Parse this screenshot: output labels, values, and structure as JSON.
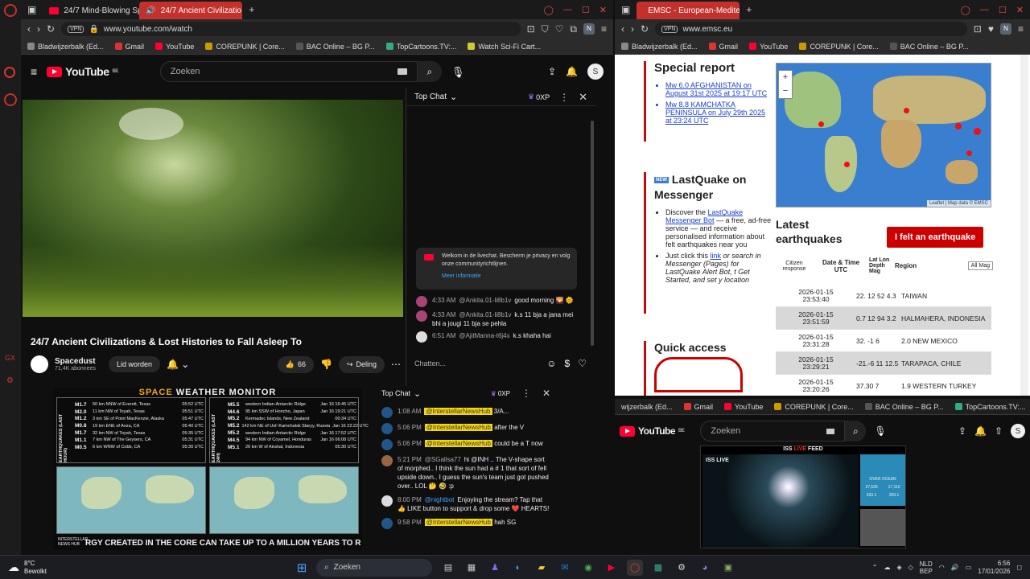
{
  "left_browser": {
    "tabs": [
      {
        "label": "24/7 Mind-Blowing Space",
        "active": false
      },
      {
        "label": "24/7 Ancient Civilizatio",
        "active": true
      }
    ],
    "url": "www.youtube.com/watch",
    "vpn": "VPN",
    "bookmarks": [
      "Bladwijzerbalk (Ed...",
      "Gmail",
      "YouTube",
      "COREPUNK | Core...",
      "BAC Online – BG P...",
      "TopCartoons.TV:...",
      "Watch Sci-Fi Cart..."
    ]
  },
  "youtube_main": {
    "logo": "YouTube",
    "region": "BE",
    "search_placeholder": "Zoeken",
    "avatar_letter": "S",
    "video_title": "24/7 Ancient Civilizations & Lost Histories to Fall Asleep To",
    "channel_name": "Spacedust",
    "subscribers": "71,4K abonnees",
    "join_label": "Lid worden",
    "likes": "66",
    "share_label": "Deling"
  },
  "chat_main": {
    "header": "Top Chat",
    "points": "0XP",
    "welcome_text": "Welkom in de livechat. Bescherm je privacy en volg onze communityrichtlijnen.",
    "more_info": "Meer informatie",
    "messages": [
      {
        "time": "4:33 AM",
        "user": "@Ankita.01-li8b1v",
        "text": "good morning 🌄 🌞"
      },
      {
        "time": "4:33 AM",
        "user": "@Ankita.01-li8b1v",
        "text": "k.s 11 bja a jana mei bhi a jougi 11 bja se pehla"
      },
      {
        "time": "6:51 AM",
        "user": "@AjitManna-t6j4x",
        "text": "k.s khaha hai"
      }
    ],
    "input_placeholder": "Chatten..."
  },
  "space_weather": {
    "title_a": "SPACE",
    "title_b": "WEATHER MONITOR",
    "left_label": "EARTHQUAKES (LAST HOUR)",
    "right_label": "EARTHQUAKES (LAST 24H)",
    "left_rows": [
      {
        "mag": "M1.7",
        "place": "50 km NNW of Everett, Texas",
        "time": "05:52 UTC"
      },
      {
        "mag": "M2.0",
        "place": "11 km NW of Toyah, Texas",
        "time": "05:51 UTC"
      },
      {
        "mag": "M1.2",
        "place": "3 km SE of Point MacKenzie, Alaska",
        "time": "05:47 UTC"
      },
      {
        "mag": "M0.8",
        "place": "19 km ENE of Anza, CA",
        "time": "05:40 UTC"
      },
      {
        "mag": "M1.7",
        "place": "32 km NW of Toyah, Texas",
        "time": "05:35 UTC"
      },
      {
        "mag": "M1.1",
        "place": "7 km NW of The Geysers, CA",
        "time": "05:31 UTC"
      },
      {
        "mag": "M0.5",
        "place": "6 km WNW of Cobb, CA",
        "time": "05:30 UTC"
      }
    ],
    "right_rows": [
      {
        "mag": "M5.5",
        "place": "western Indian-Antarctic Ridge",
        "time": "Jan 16 16:45 UTC"
      },
      {
        "mag": "M4.6",
        "place": "95 km SSW of Honcho, Japan",
        "time": "Jan 16 19:21 UTC"
      },
      {
        "mag": "M5.2",
        "place": "Kermadec Islands, New Zealand",
        "time": "00:34 UTC"
      },
      {
        "mag": "M5.2",
        "place": "142 km NE of Ust'-Kamchatsk Staryy, Russia",
        "time": "Jan 16 22:22 UTC"
      },
      {
        "mag": "M5.2",
        "place": "western Indian-Antarctic Ridge",
        "time": "Jan 16 17:52 UTC"
      },
      {
        "mag": "M4.5",
        "place": "94 km NW of Coyamel, Honduras",
        "time": "Jan 16 06:08 UTC"
      },
      {
        "mag": "M5.1",
        "place": "26 km W of Airahal, Indonesia",
        "time": "05:30 UTC"
      }
    ],
    "ticker": "RGY CREATED IN THE CORE CAN TAKE UP TO A MILLION YEARS TO R",
    "brand": "INTERSTELLAR NEWS HUB"
  },
  "chat_second": {
    "header": "Top Chat",
    "points": "0XP",
    "messages": [
      {
        "time": "1:08 AM",
        "user": "@InterstellarNewsHub",
        "text": "3/A...",
        "highlight": true
      },
      {
        "time": "5:06 PM",
        "user": "@InterstellarNewsHub",
        "text": "after the V",
        "highlight": true
      },
      {
        "time": "5:06 PM",
        "user": "@InterstellarNewsHub",
        "text": "could be a T now",
        "highlight": true
      },
      {
        "time": "5:21 PM",
        "user": "@SGallsa77",
        "text": "hi @INH .. The V-shape sort of morphed.. I think the sun had a # 1 that sort of fell upside down.. I guess the sun's team just got pushed over.. LOL 🤔 🤣 :p",
        "highlight": false
      },
      {
        "time": "8:00 PM",
        "user": "@nightbot",
        "text": "Enjoying the stream? Tap that 👍 LIKE button to support & drop some ❤️ HEARTS!",
        "highlight": false
      },
      {
        "time": "9:58 PM",
        "user": "@InterstellarNewsHub",
        "text": "hah SG",
        "highlight": true
      }
    ]
  },
  "right_browser": {
    "tab": "EMSC - European-Mediter",
    "url": "www.emsc.eu",
    "vpn": "VPN",
    "bookmarks": [
      "Bladwijzerbalk (Ed...",
      "Gmail",
      "YouTube",
      "COREPUNK | Core...",
      "BAC Online – BG P..."
    ]
  },
  "emsc": {
    "special_report": "Special report",
    "reports": [
      "Mw 6.0 AFGHANISTAN on August 31st 2025 at 19:17 UTC",
      "Mw 8.8 KAMCHATKA PENINSULA on July 29th 2025 at 23:24 UTC"
    ],
    "lastquake_new": "NEW",
    "lastquake_title": "LastQuake on Messenger",
    "bullet1_pre": "Discover the",
    "bullet1_link": "LastQuake Messenger Bot",
    "bullet1_post": "— a free, ad-free service — and receive personalised information about felt earthquakes near you",
    "bullet2_pre": "Just click this",
    "bullet2_link": "link",
    "bullet2_post": "or search in Messenger (Pages) for LastQuake Alert Bot, t Get Started, and set y location",
    "map_attribution": "Leaflet | Map data © EMSC",
    "map_zoom_in": "+",
    "map_zoom_out": "−",
    "latest_title": "Latest earthquakes",
    "felt_button": "I felt an earthquake",
    "columns": [
      "Citizen response",
      "Date & Time UTC",
      "Lat Lon Depth Mag",
      "Region"
    ],
    "mag_filter": "All Mag",
    "quakes": [
      {
        "date": "2026-01-15",
        "time": "23:53:40",
        "vals": "22. 12 52 4.3",
        "region": "TAIWAN"
      },
      {
        "date": "2026-01-15",
        "time": "23:51:59",
        "vals": "0.7 12 94 3.2",
        "region": "HALMAHERA, INDONESIA"
      },
      {
        "date": "2026-01-15",
        "time": "23:31:28",
        "vals": "32. -1 6",
        "region": "2.0 NEW MEXICO"
      },
      {
        "date": "2026-01-15",
        "time": "23:29:21",
        "vals": "-21.-6 11 12.5",
        "region": "TARAPACA, CHILE"
      },
      {
        "date": "2026-01-15",
        "time": "23:20:26",
        "vals": "37.30 7",
        "region": "1.9 WESTERN TURKEY"
      }
    ],
    "quick_access": "Quick access"
  },
  "youtube_second": {
    "bookmarks": [
      "wijzerbalk (Ed...",
      "Gmail",
      "YouTube",
      "COREPUNK | Core...",
      "BAC Online – BG P...",
      "TopCartoons.TV:..."
    ],
    "logo": "YouTube",
    "region": "BE",
    "search_placeholder": "Zoeken",
    "avatar_letter": "S",
    "feed_title_a": "ISS",
    "feed_title_live": "LIVE",
    "feed_title_b": "FEED",
    "iss_live": "ISS LIVE",
    "over_ocean": "OVER OCEAN",
    "stats": [
      "27,536",
      "17,110",
      "433.1",
      "269.1"
    ]
  },
  "taskbar": {
    "weather_temp": "8°C",
    "weather_desc": "Bewolkt",
    "search_placeholder": "Zoeken",
    "lang1": "NLD",
    "lang2": "BEP",
    "time": "6:56",
    "date": "17/01/2026"
  },
  "colors": {
    "youtube_red": "#ff0033",
    "emsc_red": "#b11",
    "accent": "#3ea6ff"
  }
}
